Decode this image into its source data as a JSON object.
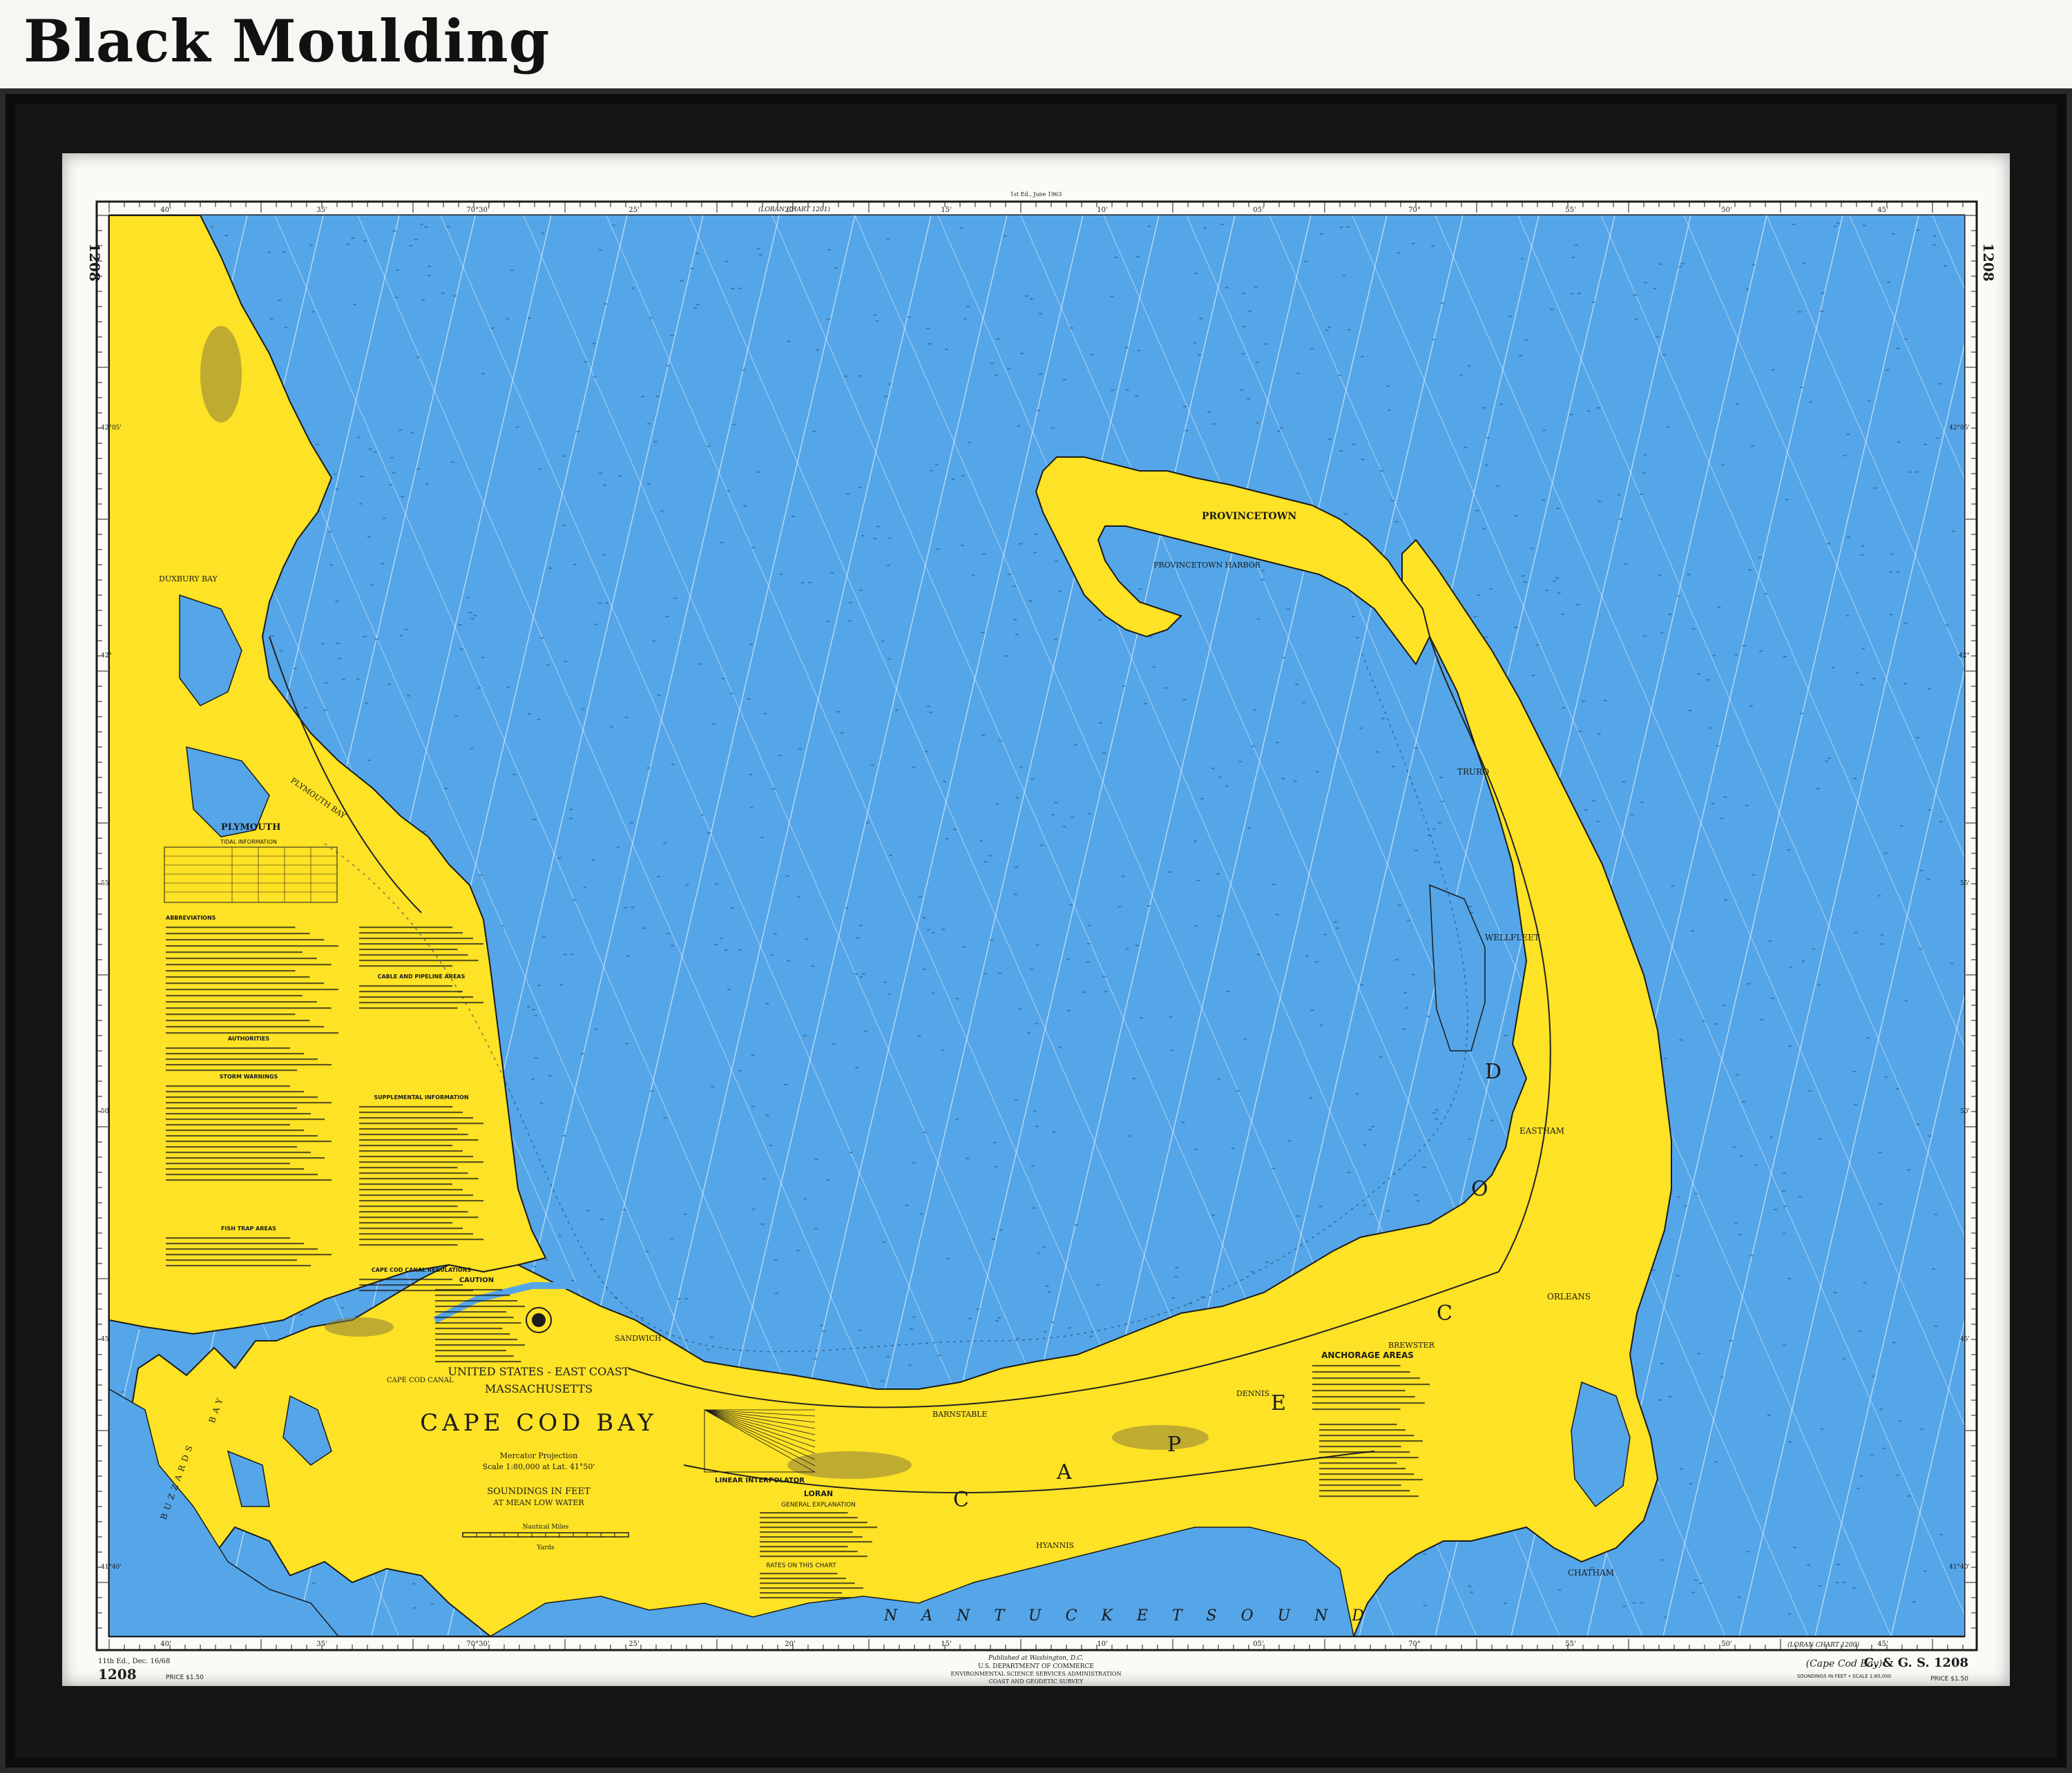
{
  "page": {
    "title": "Black Moulding"
  },
  "chart": {
    "number": "1208",
    "side_number": "1208",
    "top_edition": "1st Ed., June 1963",
    "price": "PRICE $1.50",
    "edition_note": "11th Ed., Dec. 16/68",
    "top_adjoining": "(LORAN CHART 1201)",
    "bottom_adjoining": "(LORAN CHART 1200)",
    "cgs_number": "C. & G. S. 1208",
    "cape_cod_bay_italic": "(Cape Cod Bay)",
    "scale_note": "SOUNDINGS IN FEET • SCALE 1:80,000",
    "publisher": [
      "Published at Washington, D.C.",
      "U.S. DEPARTMENT OF COMMERCE",
      "ENVIRONMENTAL SCIENCE SERVICES ADMINISTRATION",
      "COAST AND GEODETIC SURVEY"
    ]
  },
  "title_block": {
    "line1": "UNITED STATES - EAST COAST",
    "line2": "MASSACHUSETTS",
    "line3": "CAPE COD BAY",
    "projection": "Mercator Projection",
    "scale": "Scale 1:80,000 at Lat. 41°50'",
    "soundings": "SOUNDINGS IN FEET",
    "datum": "AT MEAN LOW WATER",
    "nautical_miles": "Nautical Miles",
    "yards": "Yards"
  },
  "labels": {
    "cape_letters": [
      "C",
      "A",
      "P",
      "E"
    ],
    "cod_letters": [
      "C",
      "O",
      "D"
    ],
    "nantucket_sound": "N A N T U C K E T   S O U N D",
    "buzzards_bay": "BUZZARDS",
    "bay": "BAY",
    "provincetown": "PROVINCETOWN",
    "provincetown_harbor": "PROVINCETOWN HARBOR",
    "plymouth": "PLYMOUTH",
    "plymouth_bay": "PLYMOUTH BAY",
    "duxbury_bay": "DUXBURY BAY",
    "wellfleet": "WELLFLEET",
    "eastham": "EASTHAM",
    "orleans": "ORLEANS",
    "truro": "TRURO",
    "sandwich": "SANDWICH",
    "barnstable": "BARNSTABLE",
    "dennis": "DENNIS",
    "brewster": "BREWSTER",
    "chatham": "CHATHAM",
    "hyannis": "HYANNIS",
    "cape_cod_canal": "CAPE COD CANAL",
    "anchorage_areas": "ANCHORAGE AREAS",
    "caution": "CAUTION",
    "linear_interpolator": "LINEAR INTERPOLATOR",
    "loran": "LORAN",
    "general_explanation": "GENERAL EXPLANATION",
    "rates_on_chart": "RATES ON THIS CHART",
    "abbreviations": "ABBREVIATIONS",
    "tidal_information": "TIDAL INFORMATION",
    "authorities": "AUTHORITIES",
    "storm_warnings": "STORM WARNINGS",
    "fish_trap_areas": "FISH TRAP AREAS",
    "cable_pipeline": "CABLE AND PIPELINE AREAS",
    "supplemental_info": "SUPPLEMENTAL INFORMATION",
    "canal_regulations": "CAPE COD CANAL REGULATIONS"
  },
  "grid": {
    "longitudes": [
      "40'",
      "35'",
      "70°30'",
      "25'",
      "20'",
      "15'",
      "10'",
      "05'",
      "70°",
      "55'",
      "50'",
      "45'"
    ],
    "latitudes": [
      "42°05'",
      "42°",
      "55'",
      "50'",
      "45'",
      "41°40'"
    ]
  },
  "colors": {
    "water": "#55a6e8",
    "land": "#fde225",
    "frame": "#151515",
    "mat": "#fbfaf6",
    "ink": "#1b1b1b",
    "loran_line": "#d8ecfb"
  }
}
